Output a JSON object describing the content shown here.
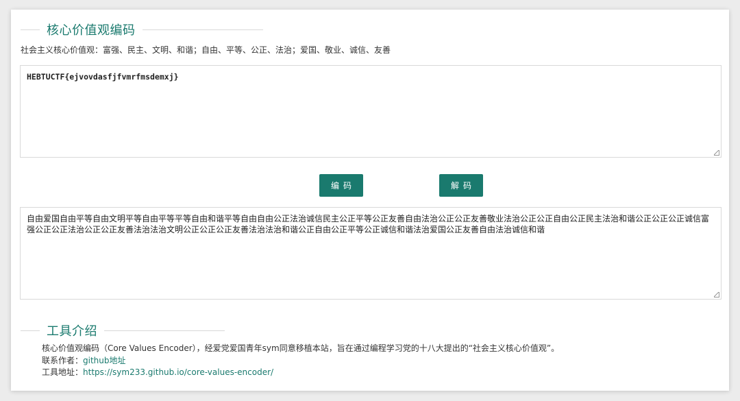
{
  "section1": {
    "title": "核心价值观编码",
    "values_line": "社会主义核心价值观：富强、民主、文明、和谐；自由、平等、公正、法治；爱国、敬业、诚信、友善"
  },
  "input": {
    "value": "HEBTUCTF{ejvovdasfjfvmrfmsdemxj}"
  },
  "buttons": {
    "encode_label": "编码",
    "decode_label": "解码"
  },
  "output": {
    "value": "自由爱国自由平等自由文明平等自由平等平等自由和谐平等自由自由公正法治诚信民主公正平等公正友善自由法治公正公正友善敬业法治公正公正自由公正民主法治和谐公正公正公正诚信富强公正公正法治公正公正友善法治法治文明公正公正公正友善法治法治和谐公正自由公正平等公正诚信和谐法治爱国公正友善自由法治诚信和谐"
  },
  "section2": {
    "title": "工具介绍",
    "description": "核心价值观编码（Core Values Encoder），经爱党爱国青年sym同意移植本站，旨在通过编程学习党的十八大提出的“社会主义核心价值观”。",
    "author_label": "联系作者：",
    "author_link": "github地址",
    "tool_label": "工具地址：",
    "tool_link": "https://sym233.github.io/core-values-encoder/"
  },
  "colors": {
    "accent": "#1a7a6e"
  }
}
